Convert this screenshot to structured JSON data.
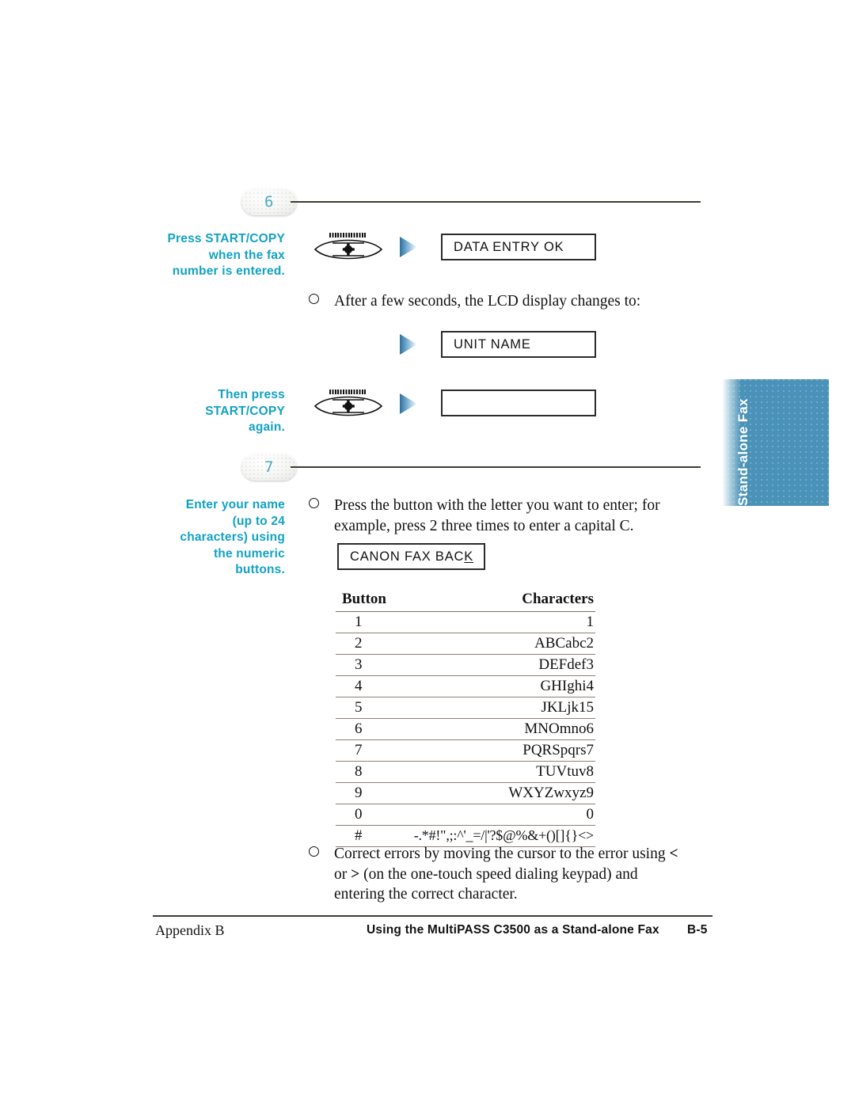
{
  "colors": {
    "callout_blue": "#12a2c4",
    "tab_blue": "#4a92b8",
    "step_number_blue": "#4aa8c6",
    "rule_dark": "#3d3d33",
    "table_rule": "#8c8077",
    "text_black": "#111111"
  },
  "side_tab": {
    "label": "Stand-alone Fax"
  },
  "steps": [
    {
      "number": "6",
      "callout": "Press START/COPY\nwhen the fax\nnumber is entered."
    },
    {
      "number": "7",
      "callout": "Enter your name\n(up to 24\ncharacters) using\nthe numeric\nbuttons."
    }
  ],
  "step6": {
    "callout2": "Then press\nSTART/COPY\nagain.",
    "lcd_data_entry": "DATA ENTRY OK",
    "lcd_unit_name": "UNIT NAME",
    "lcd_blank": "",
    "bullet_lcd_changes": "After a few seconds, the LCD display changes to:",
    "icon_start_copy": "start-copy-button-icon",
    "icon_arrow": "arrow-right-icon"
  },
  "step7": {
    "bullet_press_button": "Press the button with the letter you want to enter; for example, press 2 three times to enter a capital C.",
    "lcd_canon_fax": {
      "prefix": "CANON FAX BAC",
      "cursor_char": "K"
    },
    "bullet_correct_errors_part1": "Correct errors by moving the cursor to the error using ",
    "bullet_correct_errors_lt": "<",
    "bullet_correct_errors_mid": " or ",
    "bullet_correct_errors_gt": ">",
    "bullet_correct_errors_part2": " (on the one-touch speed dialing keypad) and entering the correct character."
  },
  "char_table": {
    "headers": [
      "Button",
      "Characters"
    ],
    "rows": [
      {
        "button": "1",
        "characters": "1"
      },
      {
        "button": "2",
        "characters": "ABCabc2"
      },
      {
        "button": "3",
        "characters": "DEFdef3"
      },
      {
        "button": "4",
        "characters": "GHIghi4"
      },
      {
        "button": "5",
        "characters": "JKLjk15"
      },
      {
        "button": "6",
        "characters": "MNOmno6"
      },
      {
        "button": "7",
        "characters": "PQRSpqrs7"
      },
      {
        "button": "8",
        "characters": "TUVtuv8"
      },
      {
        "button": "9",
        "characters": "WXYZwxyz9"
      },
      {
        "button": "0",
        "characters": "0"
      },
      {
        "button": "#",
        "characters": "-.*#!\",;:^'_=/|'?$@%&+()[]{}<>"
      }
    ]
  },
  "footer": {
    "left": "Appendix B",
    "center": "Using the MultiPASS C3500 as a Stand-alone Fax",
    "page": "B-5"
  }
}
